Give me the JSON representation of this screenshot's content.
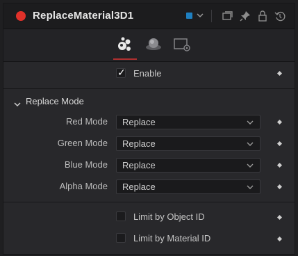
{
  "node": {
    "title": "ReplaceMaterial3D1",
    "status_color": "#e0312a",
    "swatch_color": "#1e7fc0",
    "header_icons": [
      "swatch-dropdown-chevron-icon",
      "copy-window-icon",
      "pin-icon",
      "lock-icon",
      "reset-icon"
    ]
  },
  "tabs": [
    {
      "name": "controls-tab",
      "icon": "materials-tab-icon",
      "active": true
    },
    {
      "name": "material-tab",
      "icon": "sphere-icon",
      "active": false
    },
    {
      "name": "settings-tab",
      "icon": "settings-tab-icon",
      "active": false
    }
  ],
  "enable": {
    "label": "Enable",
    "checked": true
  },
  "section": {
    "title": "Replace Mode",
    "expanded": true
  },
  "modes": [
    {
      "label": "Red Mode",
      "value": "Replace"
    },
    {
      "label": "Green Mode",
      "value": "Replace"
    },
    {
      "label": "Blue Mode",
      "value": "Replace"
    },
    {
      "label": "Alpha Mode",
      "value": "Replace"
    }
  ],
  "limits": [
    {
      "label": "Limit by Object ID",
      "checked": false
    },
    {
      "label": "Limit by Material ID",
      "checked": false
    }
  ]
}
